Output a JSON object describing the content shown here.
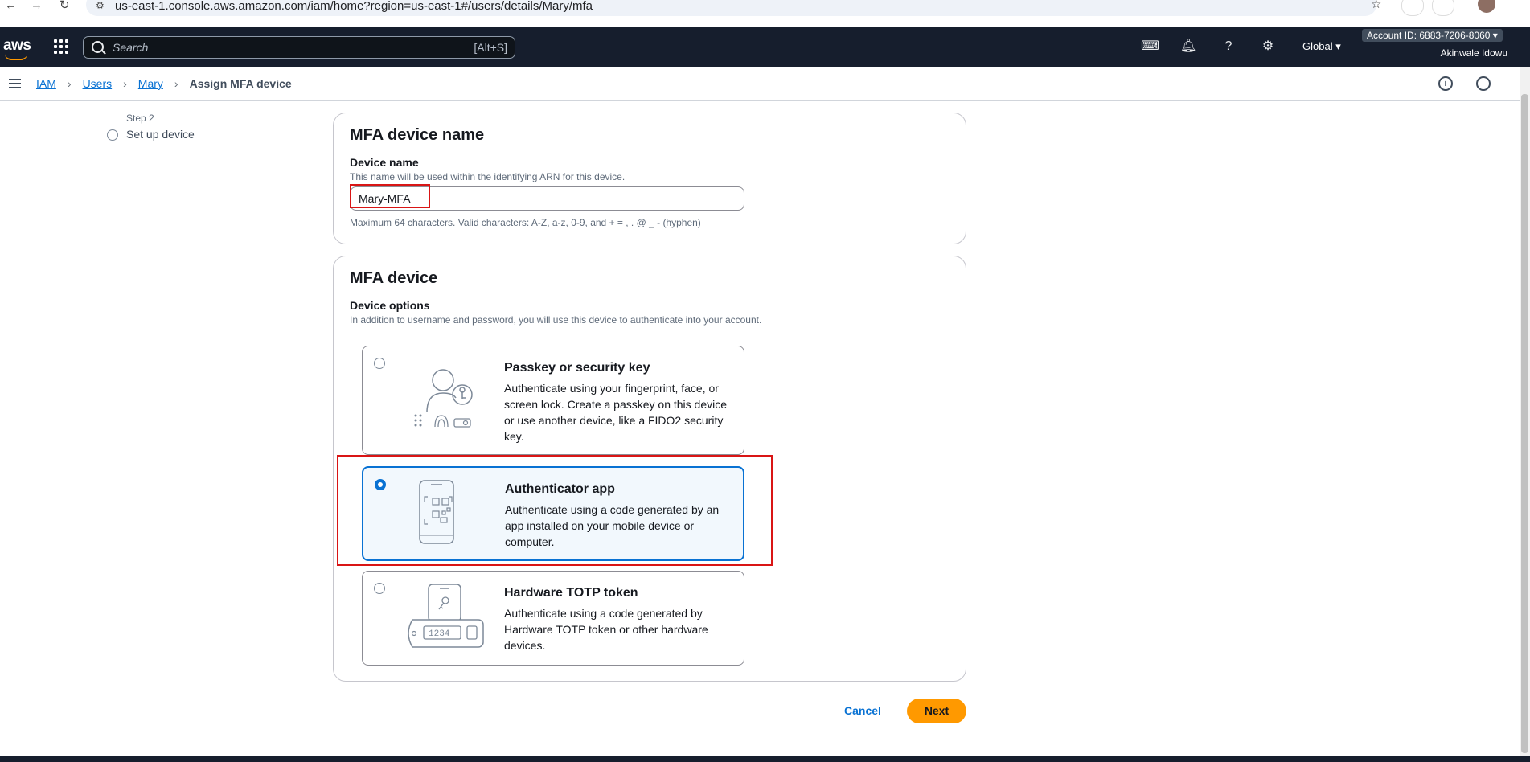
{
  "browser": {
    "url": "us-east-1.console.aws.amazon.com/iam/home?region=us-east-1#/users/details/Mary/mfa"
  },
  "topnav": {
    "logo": "aws",
    "search_placeholder": "Search",
    "search_shortcut": "[Alt+S]",
    "region": "Global ▾",
    "account": "Account ID: 6883-7206-8060 ▾",
    "user": "Akinwale Idowu"
  },
  "breadcrumb": {
    "items": [
      "IAM",
      "Users",
      "Mary"
    ],
    "current": "Assign MFA device"
  },
  "steps": {
    "step_label": "Step 2",
    "step_title": "Set up device"
  },
  "name_panel": {
    "title": "MFA device name",
    "field_label": "Device name",
    "field_desc": "This name will be used within the identifying ARN for this device.",
    "value": "Mary-MFA",
    "constraint": "Maximum 64 characters. Valid characters: A-Z, a-z, 0-9, and + = , . @ _ - (hyphen)"
  },
  "device_panel": {
    "title": "MFA device",
    "field_label": "Device options",
    "field_desc": "In addition to username and password, you will use this device to authenticate into your account.",
    "options": [
      {
        "title": "Passkey or security key",
        "desc": "Authenticate using your fingerprint, face, or screen lock. Create a passkey on this device or use another device, like a FIDO2 security key.",
        "selected": false
      },
      {
        "title": "Authenticator app",
        "desc": "Authenticate using a code generated by an app installed on your mobile device or computer.",
        "selected": true
      },
      {
        "title": "Hardware TOTP token",
        "desc": "Authenticate using a code generated by Hardware TOTP token or other hardware devices.",
        "selected": false,
        "token_display": "1234"
      }
    ]
  },
  "actions": {
    "cancel": "Cancel",
    "next": "Next"
  },
  "colors": {
    "nav_bg": "#161e2d",
    "link": "#0972d3",
    "primary_button": "#ff9900",
    "highlight": "#d91515"
  }
}
